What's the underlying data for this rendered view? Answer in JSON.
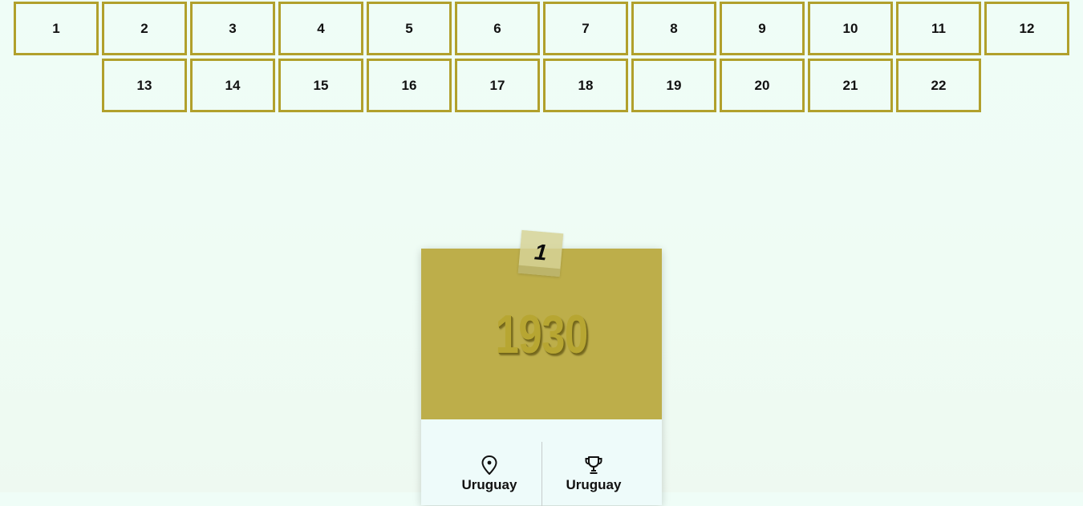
{
  "pagination": {
    "pages": [
      "1",
      "2",
      "3",
      "4",
      "5",
      "6",
      "7",
      "8",
      "9",
      "10",
      "11",
      "12",
      "13",
      "14",
      "15",
      "16",
      "17",
      "18",
      "19",
      "20",
      "21",
      "22"
    ]
  },
  "card": {
    "edition": "1",
    "year": "1930",
    "host": {
      "icon": "location-pin-icon",
      "label": "Uruguay"
    },
    "winner": {
      "icon": "trophy-icon",
      "label": "Uruguay"
    }
  },
  "colors": {
    "accent": "#b1a02c",
    "card_header": "#bdae4a",
    "background": "#effcf4"
  }
}
